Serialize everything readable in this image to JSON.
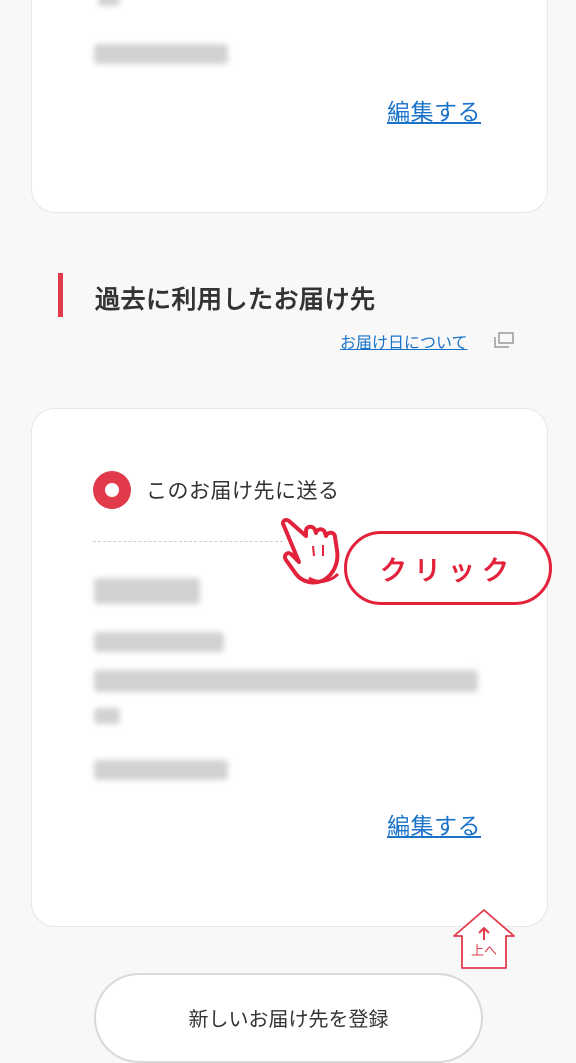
{
  "previous_card": {
    "edit_label": "編集する"
  },
  "section": {
    "title": "過去に利用したお届け先",
    "info_link": "お届け日について",
    "info_icon": "new-window-icon"
  },
  "address_card": {
    "radio_label": "このお届け先に送る",
    "radio_selected": true,
    "edit_label": "編集する"
  },
  "annotation": {
    "click_label": "クリック",
    "pointer_icon": "hand-pointer-icon"
  },
  "scroll_top": {
    "label": "上へ",
    "icon": "arrow-up-icon"
  },
  "new_address_button": {
    "label": "新しいお届け先を登録"
  },
  "colors": {
    "accent": "#e03a4b",
    "link": "#1a73c9"
  }
}
